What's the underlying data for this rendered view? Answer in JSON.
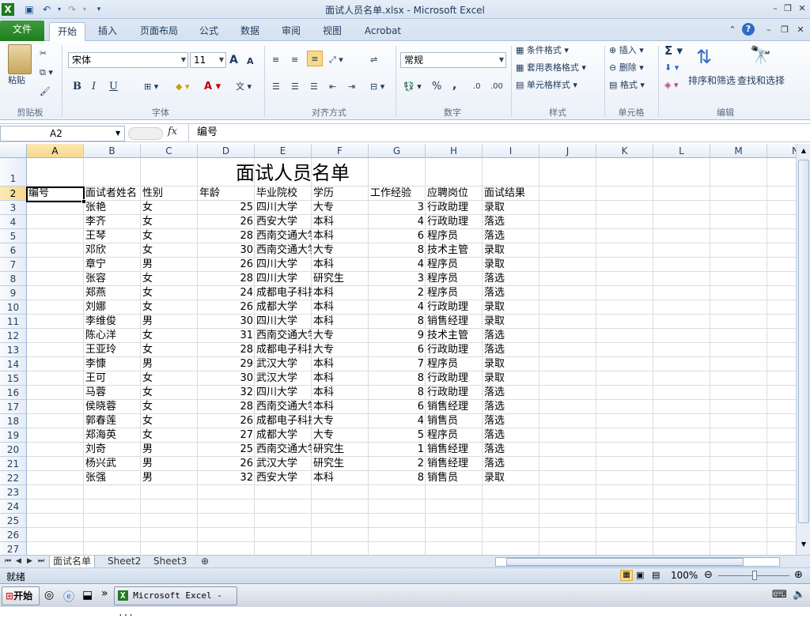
{
  "window": {
    "title": "面试人员名单.xlsx - Microsoft Excel"
  },
  "tabs": {
    "file": "文件",
    "home": "开始",
    "insert": "插入",
    "layout": "页面布局",
    "formula": "公式",
    "data": "数据",
    "review": "审阅",
    "view": "视图",
    "acrobat": "Acrobat"
  },
  "ribbon": {
    "clipboard": {
      "paste": "粘贴",
      "label": "剪贴板"
    },
    "font": {
      "name": "宋体",
      "size": "11",
      "bold": "B",
      "italic": "I",
      "underline": "U",
      "grow": "A",
      "shrink": "A",
      "label": "字体"
    },
    "align": {
      "label": "对齐方式"
    },
    "number": {
      "format": "常规",
      "percent": "%",
      "comma": ",",
      "inc": ".0",
      "dec": ".00",
      "label": "数字"
    },
    "styles": {
      "cond": "条件格式",
      "table": "套用表格格式",
      "cell": "单元格样式",
      "label": "样式"
    },
    "cells": {
      "insert": "插入",
      "delete": "删除",
      "format": "格式",
      "label": "单元格"
    },
    "editing": {
      "sort": "排序和筛选",
      "find": "查找和选择",
      "sum": "Σ",
      "label": "编辑"
    }
  },
  "formula_bar": {
    "cell_ref": "A2",
    "fx": "fx",
    "value": "编号"
  },
  "sheet": {
    "columns": [
      "A",
      "B",
      "C",
      "D",
      "E",
      "F",
      "G",
      "H",
      "I",
      "J",
      "K",
      "L",
      "M",
      "N"
    ],
    "title": "面试人员名单",
    "headers": [
      "编号",
      "面试者姓名",
      "性别",
      "年龄",
      "毕业院校",
      "学历",
      "工作经验",
      "应聘岗位",
      "面试结果"
    ],
    "rows": [
      [
        "",
        "张艳",
        "女",
        "25",
        "四川大学",
        "大专",
        "3",
        "行政助理",
        "录取"
      ],
      [
        "",
        "李齐",
        "女",
        "26",
        "西安大学",
        "本科",
        "4",
        "行政助理",
        "落选"
      ],
      [
        "",
        "王琴",
        "女",
        "28",
        "西南交通大学",
        "本科",
        "6",
        "程序员",
        "落选"
      ],
      [
        "",
        "邓欣",
        "女",
        "30",
        "西南交通大学",
        "大专",
        "8",
        "技术主管",
        "录取"
      ],
      [
        "",
        "章宁",
        "男",
        "26",
        "四川大学",
        "本科",
        "4",
        "程序员",
        "录取"
      ],
      [
        "",
        "张容",
        "女",
        "28",
        "四川大学",
        "研究生",
        "3",
        "程序员",
        "落选"
      ],
      [
        "",
        "郑燕",
        "女",
        "24",
        "成都电子科技大学",
        "本科",
        "2",
        "程序员",
        "落选"
      ],
      [
        "",
        "刘娜",
        "女",
        "26",
        "成都大学",
        "本科",
        "4",
        "行政助理",
        "录取"
      ],
      [
        "",
        "李维俊",
        "男",
        "30",
        "四川大学",
        "本科",
        "8",
        "销售经理",
        "录取"
      ],
      [
        "",
        "陈心洋",
        "女",
        "31",
        "西南交通大学",
        "大专",
        "9",
        "技术主管",
        "落选"
      ],
      [
        "",
        "王亚玲",
        "女",
        "28",
        "成都电子科技大学",
        "大专",
        "6",
        "行政助理",
        "落选"
      ],
      [
        "",
        "李慷",
        "男",
        "29",
        "武汉大学",
        "本科",
        "7",
        "程序员",
        "录取"
      ],
      [
        "",
        "王可",
        "女",
        "30",
        "武汉大学",
        "本科",
        "8",
        "行政助理",
        "录取"
      ],
      [
        "",
        "马蓉",
        "女",
        "32",
        "四川大学",
        "本科",
        "8",
        "行政助理",
        "落选"
      ],
      [
        "",
        "侯晓蓉",
        "女",
        "28",
        "西南交通大学",
        "本科",
        "6",
        "销售经理",
        "落选"
      ],
      [
        "",
        "郭春莲",
        "女",
        "26",
        "成都电子科技大学",
        "大专",
        "4",
        "销售员",
        "落选"
      ],
      [
        "",
        "郑海英",
        "女",
        "27",
        "成都大学",
        "大专",
        "5",
        "程序员",
        "落选"
      ],
      [
        "",
        "刘奇",
        "男",
        "25",
        "西南交通大学",
        "研究生",
        "1",
        "销售经理",
        "落选"
      ],
      [
        "",
        "杨兴武",
        "男",
        "26",
        "武汉大学",
        "研究生",
        "2",
        "销售经理",
        "落选"
      ],
      [
        "",
        "张强",
        "男",
        "32",
        "西安大学",
        "本科",
        "8",
        "销售员",
        "录取"
      ]
    ],
    "row_numbers": [
      "1",
      "2",
      "3",
      "4",
      "5",
      "6",
      "7",
      "8",
      "9",
      "10",
      "11",
      "12",
      "13",
      "14",
      "15",
      "16",
      "17",
      "18",
      "19",
      "20",
      "21",
      "22",
      "23",
      "24",
      "25",
      "26",
      "27"
    ]
  },
  "sheet_tabs": [
    "面试名单",
    "Sheet2",
    "Sheet3"
  ],
  "status": {
    "ready": "就绪",
    "zoom": "100%"
  },
  "taskbar": {
    "start": "开始",
    "app": "Microsoft Excel - ..."
  },
  "colors": {
    "file_tab": "#2a8a2a",
    "selection": "#f7d88a",
    "grid": "#dadcdd"
  }
}
